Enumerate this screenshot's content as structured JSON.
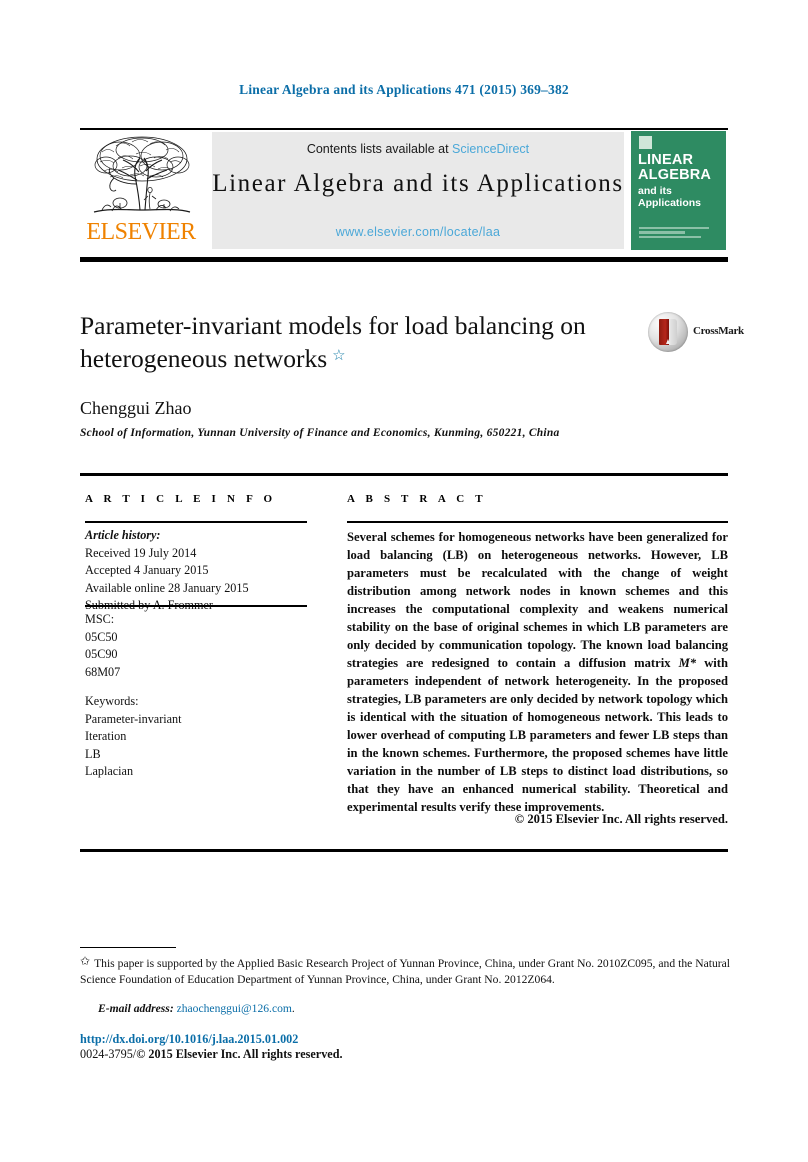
{
  "running_head": "Linear Algebra and its Applications 471 (2015) 369–382",
  "masthead": {
    "publisher_name": "ELSEVIER",
    "publisher_logo": "elsevier-tree-logo",
    "contents_prefix": "Contents lists available at",
    "contents_link": "ScienceDirect",
    "journal_title": "Linear Algebra and its Applications",
    "journal_url": "www.elsevier.com/locate/laa",
    "cover": {
      "line1": "LINEAR",
      "line2": "ALGEBRA",
      "line3": "and its",
      "line4": "Applications",
      "background_color": "#2e8b62"
    }
  },
  "article": {
    "title": "Parameter-invariant models for load balancing on heterogeneous networks",
    "title_footnote_marker": "☆",
    "authors": "Chenggui Zhao",
    "affiliation": "School of Information, Yunnan University of Finance and Economics, Kunming, 650221, China",
    "crossmark_label": "CrossMark"
  },
  "info": {
    "heading": "A R T I C L E   I N F O",
    "history_label": "Article history:",
    "history": [
      "Received 19 July 2014",
      "Accepted 4 January 2015",
      "Available online 28 January 2015",
      "Submitted by A. Frommer"
    ],
    "msc_label": "MSC:",
    "msc": [
      "05C50",
      "05C90",
      "68M07"
    ],
    "keywords_label": "Keywords:",
    "keywords": [
      "Parameter-invariant",
      "Iteration",
      "LB",
      "Laplacian"
    ]
  },
  "abstract": {
    "heading": "A B S T R A C T",
    "text_part1": "Several schemes for homogeneous networks have been generalized for load balancing (LB) on heterogeneous networks. However, LB parameters must be recalculated with the change of weight distribution among network nodes in known schemes and this increases the computational complexity and weakens numerical stability on the base of original schemes in which LB parameters are only decided by communication topology. The known load balancing strategies are redesigned to contain a diffusion matrix ",
    "math_symbol": "M*",
    "text_part2": " with parameters independent of network heterogeneity. In the proposed strategies, LB parameters are only decided by network topology which is identical with the situation of homogeneous network. This leads to lower overhead of computing LB parameters and fewer LB steps than in the known schemes. Furthermore, the proposed schemes have little variation in the number of LB steps to distinct load distributions, so that they have an enhanced numerical stability. Theoretical and experimental results verify these improvements.",
    "copyright": "© 2015 Elsevier Inc. All rights reserved."
  },
  "footnotes": {
    "marker": "✩",
    "grant_note": "This paper is supported by the Applied Basic Research Project of Yunnan Province, China, under Grant No. 2010ZC095, and the Natural Science Foundation of Education Department of Yunnan Province, China, under Grant No. 2012Z064.",
    "email_label": "E-mail address:",
    "email_address": "zhaochenggui@126.com",
    "email_suffix": "."
  },
  "footer": {
    "doi": "http://dx.doi.org/10.1016/j.laa.2015.01.002",
    "issn_line_plain": "0024-3795/",
    "issn_line_bold": "© 2015 Elsevier Inc. All rights reserved."
  },
  "colors": {
    "link_blue": "#0b6ea8",
    "science_direct_blue": "#4ba8d8",
    "elsevier_orange": "#ef8200",
    "cover_green": "#2e8b62",
    "crossmark_red": "#b5261a"
  }
}
